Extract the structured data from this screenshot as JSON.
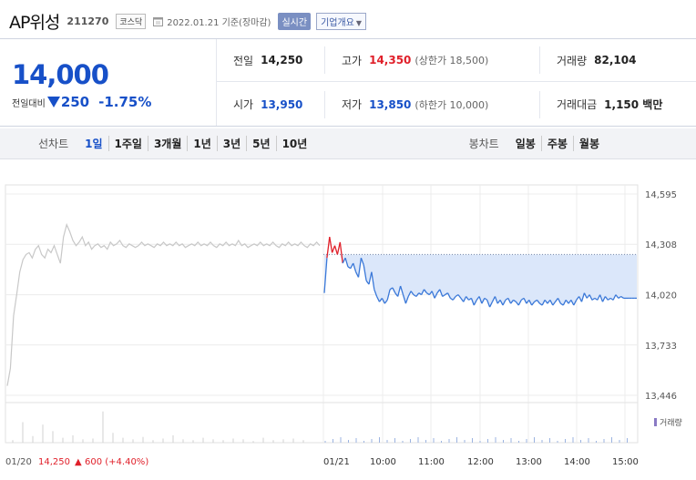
{
  "header": {
    "name": "AP위성",
    "code": "211270",
    "market": "코스닥",
    "date": "2022.01.21 기준(장마감)",
    "realtime": "실시간",
    "company_info": "기업개요"
  },
  "quote": {
    "price": "14,000",
    "change_label": "전일대비",
    "change_amount": "250",
    "change_pct": "-1.75%",
    "prev_close_label": "전일",
    "prev_close": "14,250",
    "high_label": "고가",
    "high": "14,350",
    "upper_limit": "(상한가 18,500)",
    "volume_label": "거래량",
    "volume": "82,104",
    "open_label": "시가",
    "open": "13,950",
    "low_label": "저가",
    "low": "13,850",
    "lower_limit": "(하한가 10,000)",
    "amount_label": "거래대금",
    "amount": "1,150 백만"
  },
  "period_bar": {
    "line_label": "선차트",
    "line_items": [
      "1일",
      "1주일",
      "3개월",
      "1년",
      "3년",
      "5년",
      "10년"
    ],
    "active": "1일",
    "candle_label": "봉차트",
    "candle_items": [
      "일봉",
      "주봉",
      "월봉"
    ]
  },
  "chart_data": {
    "type": "line",
    "y_ticks": [
      "14,595",
      "14,308",
      "14,020",
      "13,733",
      "13,446"
    ],
    "ylim": [
      13446,
      14595
    ],
    "reference_price": 14250,
    "x_ticks": [
      "01/20",
      "01/21",
      "10:00",
      "11:00",
      "12:00",
      "13:00",
      "14:00",
      "15:00"
    ],
    "volume_legend": "거래량",
    "footer_date": "01/20",
    "footer_price": "14,250",
    "footer_change": "600 (+4.40%)",
    "prev_day_series": [
      13500,
      13600,
      13900,
      14020,
      14150,
      14220,
      14250,
      14260,
      14230,
      14280,
      14300,
      14250,
      14230,
      14280,
      14260,
      14300,
      14250,
      14200,
      14350,
      14420,
      14380,
      14330,
      14300,
      14320,
      14350,
      14300,
      14320,
      14280,
      14300,
      14310,
      14290,
      14300,
      14280,
      14320,
      14300,
      14310,
      14330,
      14300,
      14290,
      14310,
      14300,
      14290,
      14300,
      14320,
      14300,
      14310,
      14300,
      14290,
      14310,
      14300,
      14320,
      14300,
      14310,
      14300,
      14320,
      14300,
      14310,
      14290,
      14300,
      14310,
      14300,
      14320,
      14300,
      14310,
      14300,
      14320,
      14300,
      14290,
      14310,
      14300,
      14320,
      14300,
      14310,
      14300,
      14330,
      14300,
      14310,
      14290,
      14300,
      14310,
      14300,
      14320,
      14300,
      14310,
      14300,
      14320,
      14300,
      14290,
      14310,
      14300,
      14320,
      14300,
      14310,
      14300,
      14320,
      14300,
      14290,
      14310,
      14300,
      14320,
      14300
    ],
    "today_series": [
      14030,
      14230,
      14350,
      14260,
      14300,
      14250,
      14320,
      14200,
      14230,
      14180,
      14170,
      14200,
      14150,
      14120,
      14230,
      14190,
      14100,
      14080,
      14150,
      14050,
      14010,
      13980,
      14000,
      13970,
      13990,
      14050,
      14060,
      14030,
      14010,
      14070,
      14020,
      13970,
      14010,
      14040,
      14020,
      14010,
      14030,
      14020,
      14050,
      14030,
      14020,
      14040,
      14000,
      14030,
      14050,
      14010,
      14020,
      14030,
      14000,
      13990,
      14010,
      14020,
      14000,
      13980,
      14010,
      13990,
      14000,
      13960,
      13990,
      14010,
      13970,
      14000,
      13990,
      13950,
      13980,
      14010,
      13970,
      13990,
      13960,
      13990,
      14000,
      13970,
      13990,
      13980,
      13960,
      13990,
      14000,
      13970,
      13990,
      13960,
      13980,
      13990,
      13970,
      13960,
      13990,
      13970,
      13990,
      13960,
      13980,
      14000,
      13970,
      13960,
      13990,
      13970,
      13990,
      13960,
      13990,
      14010,
      13980,
      14030,
      14000,
      14020,
      13990,
      14000,
      13990,
      14020,
      13980,
      14010,
      13990,
      14000,
      13990,
      14020,
      14000,
      14010,
      14000,
      14000,
      14000,
      14000,
      14000,
      14000
    ]
  },
  "colors": {
    "accent_blue": "#1750c8",
    "up_red": "#e0202a",
    "line_blue": "#3a78d8",
    "prev_gray": "#c8c8c8",
    "fill_blue": "#dbe7fa"
  }
}
